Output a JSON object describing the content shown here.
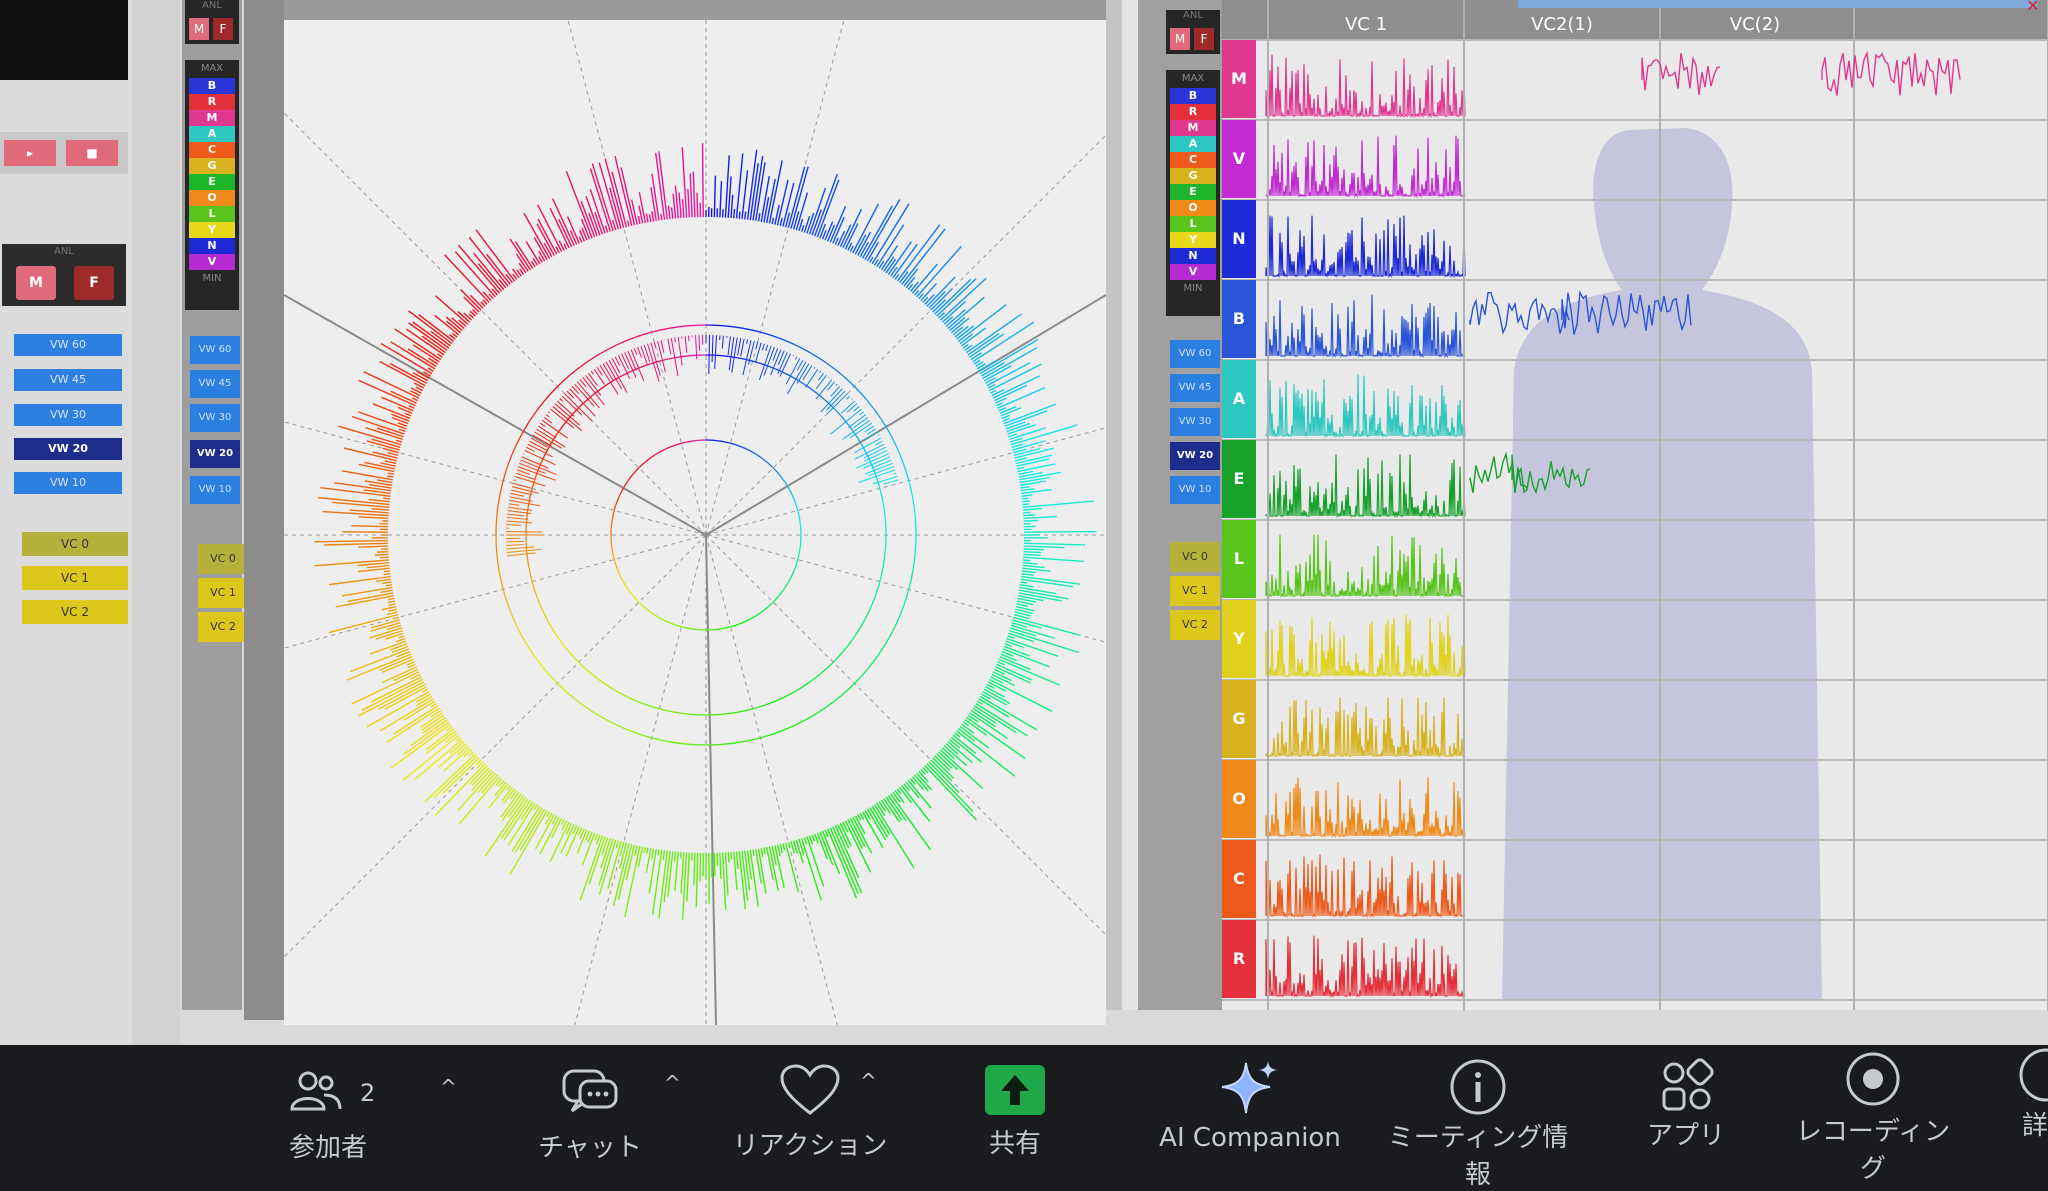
{
  "left_panel": {
    "record_buttons": [
      "▸",
      "■"
    ],
    "anl_label": "ANL",
    "mf": [
      "M",
      "F"
    ],
    "vw_buttons": [
      "VW 60",
      "VW 45",
      "VW 30",
      "VW 20",
      "VW 10"
    ],
    "vc_buttons": [
      "VC 0",
      "VC 1",
      "VC 2"
    ]
  },
  "color_key": {
    "anl_label": "ANL",
    "mf": [
      "M",
      "F"
    ],
    "max_label": "MAX",
    "min_label": "MIN",
    "rows": [
      {
        "label": "B",
        "color": "#2a35d8"
      },
      {
        "label": "R",
        "color": "#e4303a"
      },
      {
        "label": "M",
        "color": "#e03790"
      },
      {
        "label": "A",
        "color": "#2fc8c0"
      },
      {
        "label": "C",
        "color": "#ee5a1c"
      },
      {
        "label": "G",
        "color": "#d8b21e"
      },
      {
        "label": "E",
        "color": "#1db52a"
      },
      {
        "label": "O",
        "color": "#ef8a1a"
      },
      {
        "label": "L",
        "color": "#58c41c"
      },
      {
        "label": "Y",
        "color": "#e8d81c"
      },
      {
        "label": "N",
        "color": "#1e2ad6"
      },
      {
        "label": "V",
        "color": "#b62ad2"
      }
    ],
    "vw_buttons": [
      "VW 60",
      "VW 45",
      "VW 30",
      "VW 20",
      "VW 10"
    ],
    "vc_buttons": [
      "VC 0",
      "VC 1",
      "VC 2"
    ]
  },
  "right_panel": {
    "anl_label": "ANL",
    "mf": [
      "M",
      "F"
    ],
    "max_label": "MAX",
    "min_label": "MIN",
    "headers": [
      "VC 1",
      "VC2(1)",
      "VC(2)"
    ],
    "rows": [
      {
        "label": "M",
        "color": "#e03790"
      },
      {
        "label": "V",
        "color": "#c22ad2"
      },
      {
        "label": "N",
        "color": "#1e2ad6"
      },
      {
        "label": "B",
        "color": "#2a55d8"
      },
      {
        "label": "A",
        "color": "#2fc8c0"
      },
      {
        "label": "E",
        "color": "#16a12a"
      },
      {
        "label": "L",
        "color": "#58c41c"
      },
      {
        "label": "Y",
        "color": "#e0d21c"
      },
      {
        "label": "G",
        "color": "#d8b21e"
      },
      {
        "label": "O",
        "color": "#ef8a1a"
      },
      {
        "label": "C",
        "color": "#ee5a1c"
      },
      {
        "label": "R",
        "color": "#e4303a"
      }
    ]
  },
  "taskbar": {
    "participants": {
      "label": "参加者",
      "count": "2"
    },
    "chat": {
      "label": "チャット"
    },
    "reactions": {
      "label": "リアクション"
    },
    "share": {
      "label": "共有"
    },
    "ai_companion": {
      "label": "AI Companion"
    },
    "meeting_info": {
      "label": "ミーティング情報"
    },
    "apps": {
      "label": "アプリ"
    },
    "recording": {
      "label": "レコーディング"
    },
    "details": {
      "label": "詳"
    },
    "caret": "^"
  },
  "colors": {
    "share_green": "#1fa84a",
    "bar_bg": "#1a1b1f"
  }
}
